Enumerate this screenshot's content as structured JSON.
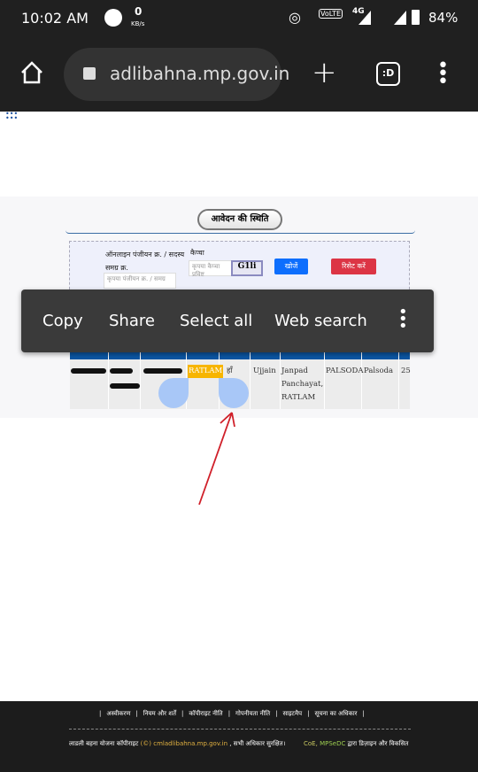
{
  "status": {
    "time": "10:02 AM",
    "net_speed": "0",
    "net_unit": "KB/s",
    "network": "4G",
    "battery": "84%"
  },
  "browser": {
    "url": "adlibahna.mp.gov.in"
  },
  "page": {
    "section_title": "आवेदन की स्थिति",
    "reg_label": "ऑनलाइन पंजीयन क्र. / सदस्य समग्र क्र.",
    "reg_placeholder": "कृपया पंजीयन क्र. / समग्र",
    "captcha_label": "कैप्चा",
    "captcha_placeholder": "कृपया कैप्चा प्रविष्ट",
    "captcha_image_text": "G1li",
    "search_button": "खोजें",
    "reset_button": "रिसेट करें"
  },
  "context_menu": {
    "items": [
      "Copy",
      "Share",
      "Select all",
      "Web search"
    ]
  },
  "table": {
    "row": [
      "RATLAM",
      "हाँ",
      "Ujjain",
      "Janpad Panchayat, RATLAM",
      "PALSODA",
      "Palsoda",
      "25"
    ]
  },
  "footer": {
    "links": [
      "अस्वीकरण",
      "नियम और शर्तें",
      "कॉपीराइट नीति",
      "गोपनीयता नीति",
      "साइटमैप",
      "सूचना का अधिकार"
    ],
    "copyright_prefix": "लाडली बहना योजना कॉपीराइट",
    "copyright_link": "(©) cmladlibahna.mp.gov.in",
    "copyright_suffix": ", सभी अधिकार सुरक्षित।",
    "credit_coe": "CoE,",
    "credit_mpsedc": "MPSeDC",
    "credit_suffix": "द्वारा डिज़ाइन और विकसित"
  },
  "colors": {
    "highlight": "#f7b500",
    "search": "#0d6efd",
    "reset": "#dc3545",
    "arrow": "#d0202a"
  }
}
